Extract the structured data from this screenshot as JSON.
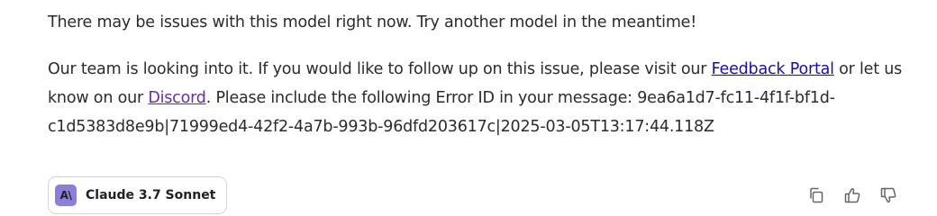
{
  "message": {
    "line1": "There may be issues with this model right now. Try another model in the meantime!",
    "para2_part1": "Our team is looking into it. If you would like to follow up on this issue, please visit our ",
    "feedback_link": "Feedback Portal",
    "para2_part2": " or let us know on our ",
    "discord_link": "Discord",
    "para2_part3": ". Please include the following Error ID in your message: 9ea6a1d7-fc11-4f1f-bf1d-c1d5383d8e9b|71999ed4-42f2-4a7b-993b-96dfd203617c|2025-03-05T13:17:44.118Z"
  },
  "model_chip": {
    "logo_text": "A\\",
    "name": "Claude 3.7 Sonnet"
  },
  "icons": {
    "copy": "copy-icon",
    "like": "thumbs-up-icon",
    "dislike": "thumbs-down-icon"
  },
  "colors": {
    "link": "#1a0dab",
    "visited_link": "#6c2aa6",
    "logo_bg": "#8b7fd8"
  }
}
